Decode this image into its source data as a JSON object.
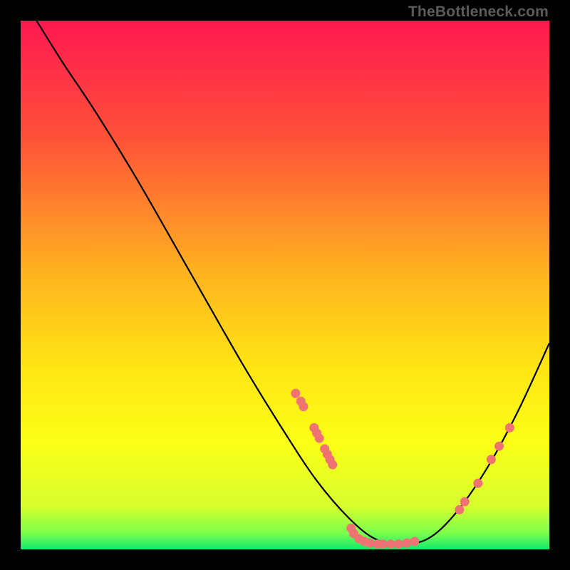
{
  "watermark": "TheBottleneck.com",
  "chart_data": {
    "type": "line",
    "title": "",
    "xlabel": "",
    "ylabel": "",
    "xlim": [
      0,
      100
    ],
    "ylim": [
      0,
      100
    ],
    "background_gradient": {
      "stops": [
        {
          "offset": 0,
          "color": "#ff1850"
        },
        {
          "offset": 22,
          "color": "#ff5139"
        },
        {
          "offset": 48,
          "color": "#ffb41f"
        },
        {
          "offset": 66,
          "color": "#ffe614"
        },
        {
          "offset": 80,
          "color": "#fbff16"
        },
        {
          "offset": 92,
          "color": "#d6ff2e"
        },
        {
          "offset": 97,
          "color": "#78ff4e"
        },
        {
          "offset": 100,
          "color": "#13e86c"
        }
      ]
    },
    "curve": [
      {
        "x": 3.0,
        "y": 100.0
      },
      {
        "x": 8.0,
        "y": 92.0
      },
      {
        "x": 14.0,
        "y": 83.0
      },
      {
        "x": 22.0,
        "y": 70.0
      },
      {
        "x": 32.0,
        "y": 52.5
      },
      {
        "x": 42.0,
        "y": 35.0
      },
      {
        "x": 50.0,
        "y": 22.0
      },
      {
        "x": 56.0,
        "y": 13.0
      },
      {
        "x": 62.0,
        "y": 6.0
      },
      {
        "x": 67.0,
        "y": 2.0
      },
      {
        "x": 72.0,
        "y": 1.0
      },
      {
        "x": 77.0,
        "y": 2.0
      },
      {
        "x": 82.0,
        "y": 6.5
      },
      {
        "x": 88.0,
        "y": 15.0
      },
      {
        "x": 94.0,
        "y": 26.0
      },
      {
        "x": 100.0,
        "y": 39.0
      }
    ],
    "scatter_points": [
      {
        "x": 52.0,
        "y": 29.5
      },
      {
        "x": 53.0,
        "y": 28.0
      },
      {
        "x": 53.5,
        "y": 27.0
      },
      {
        "x": 55.5,
        "y": 23.0
      },
      {
        "x": 56.0,
        "y": 22.0
      },
      {
        "x": 56.5,
        "y": 21.0
      },
      {
        "x": 57.5,
        "y": 19.0
      },
      {
        "x": 58.0,
        "y": 18.0
      },
      {
        "x": 58.5,
        "y": 17.0
      },
      {
        "x": 59.0,
        "y": 16.0
      },
      {
        "x": 62.5,
        "y": 4.0
      },
      {
        "x": 63.0,
        "y": 3.0
      },
      {
        "x": 64.0,
        "y": 2.0
      },
      {
        "x": 65.0,
        "y": 1.5
      },
      {
        "x": 66.0,
        "y": 1.2
      },
      {
        "x": 67.5,
        "y": 1.0
      },
      {
        "x": 68.5,
        "y": 1.0
      },
      {
        "x": 70.0,
        "y": 1.0
      },
      {
        "x": 71.5,
        "y": 1.0
      },
      {
        "x": 73.0,
        "y": 1.2
      },
      {
        "x": 74.5,
        "y": 1.5
      },
      {
        "x": 83.0,
        "y": 7.5
      },
      {
        "x": 84.0,
        "y": 9.0
      },
      {
        "x": 86.5,
        "y": 12.5
      },
      {
        "x": 89.0,
        "y": 17.0
      },
      {
        "x": 90.5,
        "y": 19.5
      },
      {
        "x": 92.5,
        "y": 23.0
      }
    ],
    "point_color": "#f07373",
    "curve_color": "#000000"
  }
}
